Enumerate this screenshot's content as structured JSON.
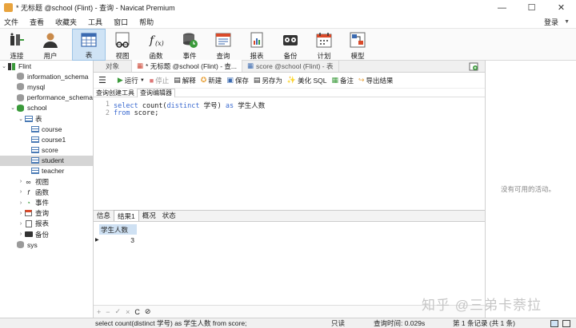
{
  "window": {
    "title": "* 无标题 @school (Flint) - 查询 - Navicat Premium"
  },
  "menu": {
    "items": [
      "文件",
      "查看",
      "收藏夹",
      "工具",
      "窗口",
      "帮助"
    ],
    "login": "登录"
  },
  "toolbar": {
    "items": [
      {
        "label": "连接",
        "icon": "connection-icon"
      },
      {
        "label": "用户",
        "icon": "user-icon"
      },
      {
        "label": "表",
        "icon": "table-icon",
        "active": true
      },
      {
        "label": "视图",
        "icon": "view-icon"
      },
      {
        "label": "函数",
        "icon": "function-icon"
      },
      {
        "label": "事件",
        "icon": "event-icon"
      },
      {
        "label": "查询",
        "icon": "query-icon"
      },
      {
        "label": "报表",
        "icon": "report-icon"
      },
      {
        "label": "备份",
        "icon": "backup-icon"
      },
      {
        "label": "计划",
        "icon": "schedule-icon"
      },
      {
        "label": "模型",
        "icon": "model-icon"
      }
    ]
  },
  "sidebar": {
    "rows": [
      {
        "label": "Flint",
        "indent": 0,
        "twisty": "⌄",
        "icon": "connection"
      },
      {
        "label": "information_schema",
        "indent": 1,
        "icon": "db"
      },
      {
        "label": "mysql",
        "indent": 1,
        "icon": "db"
      },
      {
        "label": "performance_schema",
        "indent": 1,
        "icon": "db"
      },
      {
        "label": "school",
        "indent": 1,
        "twisty": "⌄",
        "icon": "db-green"
      },
      {
        "label": "表",
        "indent": 2,
        "twisty": "⌄",
        "icon": "tables"
      },
      {
        "label": "course",
        "indent": 3,
        "icon": "table"
      },
      {
        "label": "course1",
        "indent": 3,
        "icon": "table"
      },
      {
        "label": "score",
        "indent": 3,
        "icon": "table"
      },
      {
        "label": "student",
        "indent": 3,
        "icon": "table",
        "selected": true
      },
      {
        "label": "teacher",
        "indent": 3,
        "icon": "table"
      },
      {
        "label": "视图",
        "indent": 2,
        "twisty": "›",
        "icon": "view"
      },
      {
        "label": "函数",
        "indent": 2,
        "twisty": "›",
        "icon": "function"
      },
      {
        "label": "事件",
        "indent": 2,
        "twisty": "›",
        "icon": "event"
      },
      {
        "label": "查询",
        "indent": 2,
        "twisty": "›",
        "icon": "query"
      },
      {
        "label": "报表",
        "indent": 2,
        "twisty": "›",
        "icon": "report"
      },
      {
        "label": "备份",
        "indent": 2,
        "twisty": "›",
        "icon": "backup"
      },
      {
        "label": "sys",
        "indent": 1,
        "icon": "db"
      }
    ]
  },
  "tabs": {
    "object": "对象",
    "query_tab": "* 无标题 @school (Flint) - 查...",
    "table_tab": "score @school (Flint) - 表"
  },
  "query_toolbar": {
    "run": "运行",
    "stop": "停止",
    "explain": "解释",
    "new": "新建",
    "save": "保存",
    "save_as": "另存为",
    "beautify": "美化 SQL",
    "note": "备注",
    "export": "导出结果"
  },
  "subtabs": {
    "builder": "查询创建工具",
    "editor": "查询编辑器"
  },
  "editor": {
    "line1": {
      "num": "1",
      "kw1": "select",
      "t1": " count(",
      "kw2": "distinct",
      "t2": " 学号) ",
      "kw3": "as",
      "t3": " 学生人数"
    },
    "line2": {
      "num": "2",
      "kw1": "from",
      "t1": " score;"
    }
  },
  "result_tabs": [
    "信息",
    "结果1",
    "概况",
    "状态"
  ],
  "result": {
    "column": "学生人数",
    "value": "3"
  },
  "result_footer": {
    "add": "+",
    "remove": "−",
    "check": "✓",
    "cancel": "×",
    "refresh": "C",
    "stop": "⊘"
  },
  "right_pane": {
    "message": "没有可用的活动。"
  },
  "watermark": "知乎 @三弟卡萘拉",
  "status": {
    "sql": "select count(distinct 学号) as 学生人数 from score;",
    "readonly": "只读",
    "query_time": "查询时间: 0.029s",
    "records": "第 1 条记录 (共 1 条)"
  }
}
